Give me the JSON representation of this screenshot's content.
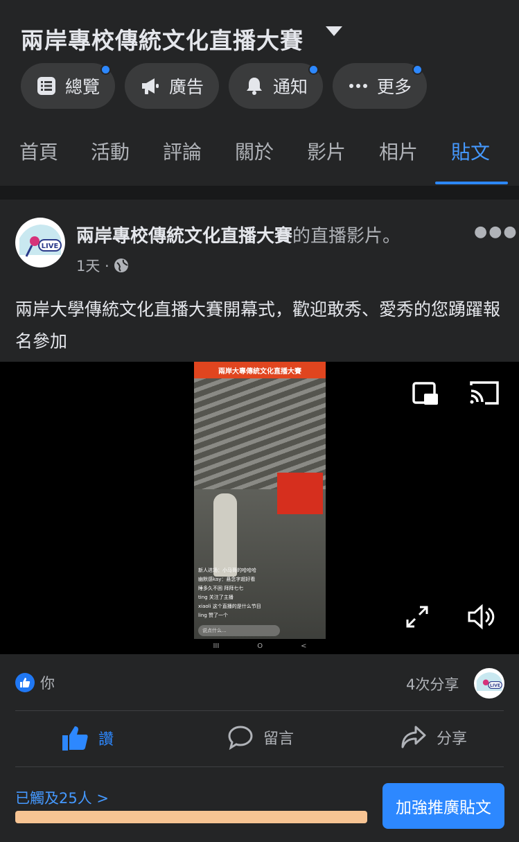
{
  "header": {
    "title": "兩岸專校傳統文化直播大賽",
    "pills": [
      {
        "label": "總覽",
        "icon": "list-icon",
        "notify": true
      },
      {
        "label": "廣告",
        "icon": "megaphone-icon",
        "notify": false
      },
      {
        "label": "通知",
        "icon": "bell-icon",
        "notify": true
      },
      {
        "label": "更多",
        "icon": "more-icon",
        "notify": true
      }
    ]
  },
  "tabs": [
    {
      "label": "首頁",
      "active": false
    },
    {
      "label": "活動",
      "active": false
    },
    {
      "label": "評論",
      "active": false
    },
    {
      "label": "關於",
      "active": false
    },
    {
      "label": "影片",
      "active": false
    },
    {
      "label": "相片",
      "active": false
    },
    {
      "label": "貼文",
      "active": true
    }
  ],
  "post": {
    "author": "兩岸專校傳統文化直播大賽",
    "author_suffix": "的直播影片。",
    "time": "1天 ·",
    "text": "兩岸大學傳統文化直播大賽開幕式，歡迎敢秀、愛秀的您踴躍報名參加",
    "avatar_text": "LIVE",
    "video": {
      "banner": "兩岸大專傳統文化直播大賽",
      "chat": [
        "新人进场：小马哥的哈哈哈",
        "幽默感kay：悬念字超好看",
        "睡多久不困 拜拜七七",
        "ting 关注了主播",
        "xiaoli 这个直播的是什么节目",
        "ling 赞了一个"
      ],
      "input_placeholder": "说点什么...",
      "nav": [
        "III",
        "O",
        "<"
      ]
    },
    "reactions_text": "你",
    "shares_text": "4次分享",
    "actions": {
      "like": "讚",
      "comment": "留言",
      "share": "分享"
    },
    "reach_text": "已觸及25人 >",
    "boost_label": "加強推廣貼文"
  },
  "colors": {
    "accent": "#2d88ff",
    "background": "#242526",
    "reach_bar": "#f7c493"
  }
}
